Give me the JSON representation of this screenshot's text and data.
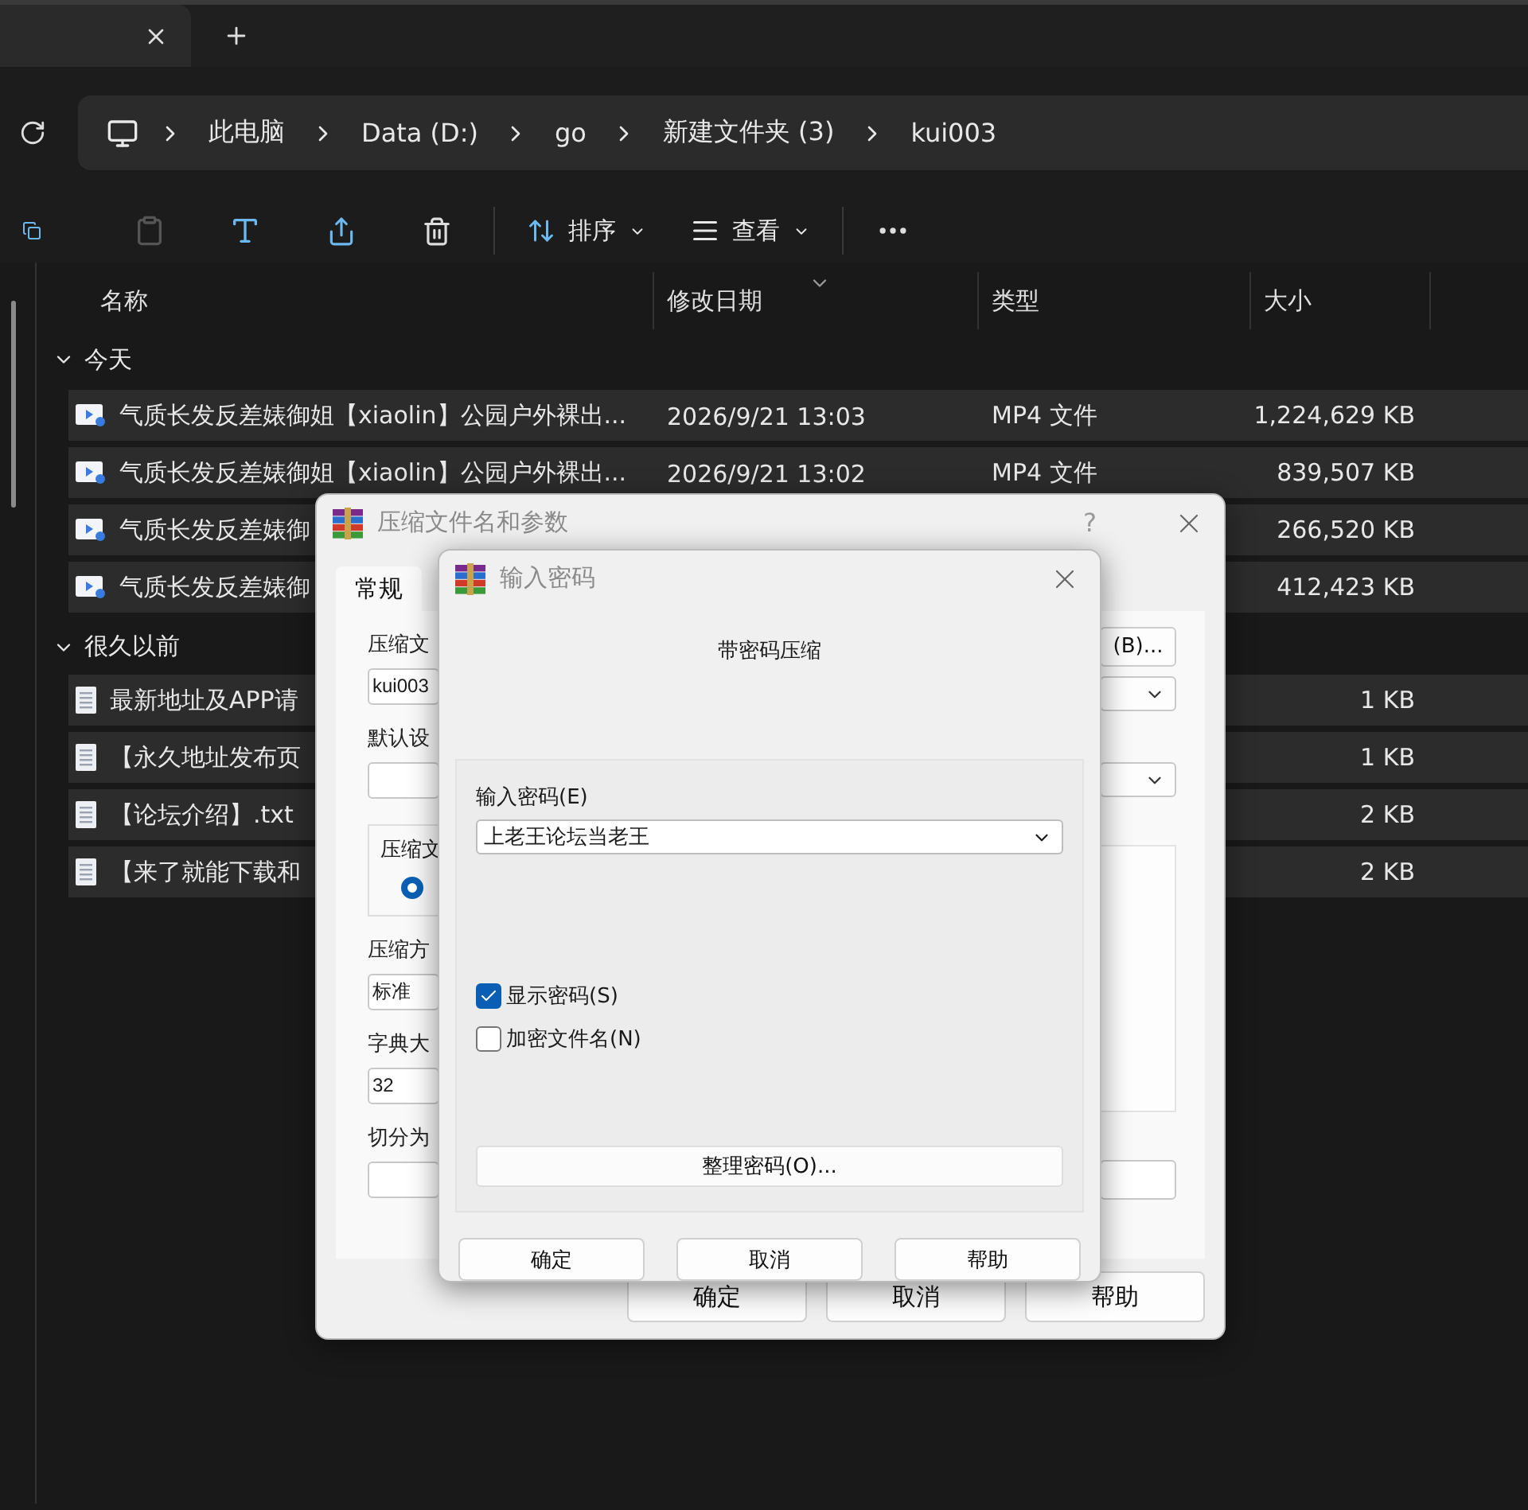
{
  "address_bar": {
    "crumbs": [
      "此电脑",
      "Data (D:)",
      "go",
      "新建文件夹 (3)",
      "kui003"
    ]
  },
  "toolbar": {
    "sort_label": "排序",
    "view_label": "查看"
  },
  "columns": [
    {
      "label": "名称",
      "sorted": false
    },
    {
      "label": "修改日期",
      "sorted": true
    },
    {
      "label": "类型",
      "sorted": false
    },
    {
      "label": "大小",
      "sorted": false
    }
  ],
  "groups": [
    {
      "label": "今天",
      "expanded": true,
      "files": [
        {
          "kind": "video",
          "name": "气质长发反差婊御姐【xiaolin】公园户外裸出...",
          "date": "2026/9/21 13:03",
          "type": "MP4 文件",
          "size": "1,224,629 KB"
        },
        {
          "kind": "video",
          "name": "气质长发反差婊御姐【xiaolin】公园户外裸出...",
          "date": "2026/9/21 13:02",
          "type": "MP4 文件",
          "size": "839,507 KB"
        },
        {
          "kind": "video",
          "name": "气质长发反差婊御",
          "size": "266,520 KB"
        },
        {
          "kind": "video",
          "name": "气质长发反差婊御",
          "size": "412,423 KB"
        }
      ]
    },
    {
      "label": "很久以前",
      "expanded": true,
      "files": [
        {
          "kind": "text",
          "name": "最新地址及APP请",
          "size": "1 KB"
        },
        {
          "kind": "text",
          "name": "【永久地址发布页",
          "size": "1 KB"
        },
        {
          "kind": "text",
          "name": "【论坛介绍】.txt",
          "size": "2 KB"
        },
        {
          "kind": "text",
          "name": "【来了就能下载和",
          "size": "2 KB"
        }
      ]
    }
  ],
  "archive_dialog": {
    "title": "压缩文件名和参数",
    "help": "?",
    "tabs": [
      {
        "label": "常规",
        "selected": true
      }
    ],
    "left_items": [
      {
        "kind": "label",
        "text": "压缩文"
      },
      {
        "kind": "field",
        "value": "kui003"
      },
      {
        "kind": "label",
        "text": "默认设"
      },
      {
        "kind": "field"
      },
      {
        "kind": "group",
        "text": "压缩文",
        "radio_selected": true
      },
      {
        "kind": "label",
        "text": "压缩方"
      },
      {
        "kind": "field",
        "value": "标准"
      },
      {
        "kind": "label",
        "text": "字典大"
      },
      {
        "kind": "field",
        "value": "32"
      },
      {
        "kind": "label",
        "text": "切分为"
      },
      {
        "kind": "field"
      }
    ],
    "right_items": [
      {
        "kind": "button",
        "text": "(B)..."
      },
      {
        "kind": "dropdown"
      },
      {
        "kind": "dropdown"
      },
      {
        "kind": "panel"
      },
      {
        "kind": "field"
      }
    ],
    "buttons": [
      "确定",
      "取消",
      "帮助"
    ]
  },
  "password_dialog": {
    "title": "输入密码",
    "subtitle": "带密码压缩",
    "password_label": "输入密码(E)",
    "password": "上老王论坛当老王",
    "options": [
      {
        "label": "显示密码(S)",
        "checked": true
      },
      {
        "label": "加密文件名(N)",
        "checked": false
      }
    ],
    "organize_button": "整理密码(O)...",
    "buttons": [
      "确定",
      "取消",
      "帮助"
    ]
  }
}
